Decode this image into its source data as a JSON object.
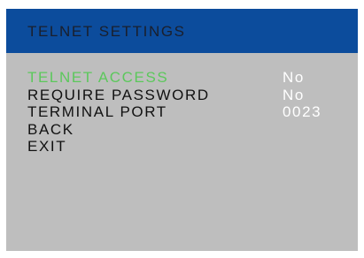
{
  "title": "TELNET SETTINGS",
  "colors": {
    "title_bar": "#0c4c9c",
    "background": "#bebebe",
    "selected_label": "#5cc85c",
    "label": "#111111",
    "value": "#ffffff"
  },
  "menu": {
    "items": [
      {
        "label": "TELNET ACCESS",
        "value": "No",
        "selected": true
      },
      {
        "label": "REQUIRE PASSWORD",
        "value": "No",
        "selected": false
      },
      {
        "label": "TERMINAL PORT",
        "value": "0023",
        "selected": false
      },
      {
        "label": "BACK",
        "value": "",
        "selected": false
      },
      {
        "label": "EXIT",
        "value": "",
        "selected": false
      }
    ]
  }
}
